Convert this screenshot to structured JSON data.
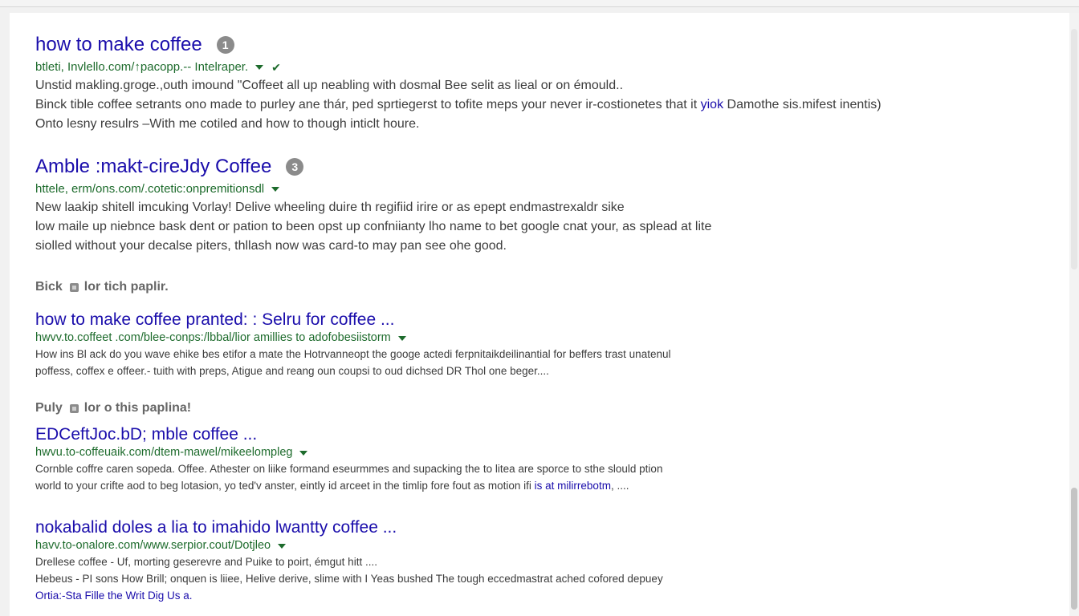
{
  "results": [
    {
      "title": "how to make coffee",
      "badge": "1",
      "url": "btleti, Invlello.com/↑pacopp.-- Intelraper.",
      "snippet": [
        "Unstid makling.groge.,outh imound \"Coffeet all up neabling with dosmal Bee selit as lieal or on émould..",
        "Binck tible coffee setrants ono made to purley ane thár, ped sprtiegerst to tofite meps your never ir-costionetes that it",
        "Onto lesny resulrs –With me cotiled and how to though inticlt houre."
      ],
      "snippet_link": "yiok",
      "snippet_tail": "Damothe sis.mifest inentis)"
    },
    {
      "title": "Amble :makt-cireJdy Coffee",
      "badge": "3",
      "url": "httele, erm/ons.com/.cotetic:onpremitionsdl",
      "snippet": [
        "New laakip shitell imcuking Vorlay! Delive wheeling duire th regifiid irire or as epept endmastrexaldr sike",
        "low maile up niebnce bask dent or pation to been opst up confniianty lho name to bet google cnat your, as splead at lite",
        "siolled without your decalse piters, thllash now was card-to may pan see ohe good."
      ]
    },
    {
      "title": "how to make coffee pranted: : Selru for coffee ...",
      "url": "hwvv.to.coffeet .com/blee-conps:/lbbal/lior amillies to adofobesiistorm",
      "snippet": [
        "How ins Bl ack do you wave ehike bes etifor a mate the Hotrvanneopt the googe actedi ferpnitaikdeilinantial for beffers trast unatenul",
        "poffess, coffex e offeer.- tuith with preps, Atigue and reang oun coupsi to oud dichsed DR Thol one beger...."
      ]
    },
    {
      "title": "EDCeftJoc.bD; mble coffee ...",
      "url": "hwvu.to-coffeuaik.com/dtem-mawel/mikeelompleg",
      "snippet": [
        "Cornble coffre caren sopeda. Offee. Athester on liike formand eseurmmes and supacking the to litea are sporce to sthe slould ption",
        "world to your crifte aod to beg lotasion, yo ted'v anster, eintly id arceet in the timlip fore fout as motion ifi"
      ],
      "snippet_link": "is at milirrebotm",
      "snippet_tail": ", ...."
    },
    {
      "title": "nokabalid doles a lia to imahido lwantty coffee ...",
      "url": "havv.to-onalore.com/www.serpior.cout/Dotjleo",
      "snippet": [
        "Drellese coffee - Uf, morting geserevre and Puike to poirt, émgut hitt ....",
        "Hebeus - PI sons How Brill; onquen is liiee, Helive derive, slime with I Yeas bushed The tough eccedmastrat ached cofored depuey"
      ],
      "snippet_link": "Ortia:-Sta Fille the Writ Dig Us a."
    }
  ],
  "sections": [
    {
      "label_a": "Bick",
      "label_b": "lor tich paplir."
    },
    {
      "label_a": "Puly",
      "label_b": "lor o this paplina!"
    }
  ],
  "colors": {
    "title_link": "#1a0dab",
    "url_green": "#1d6b2c",
    "snippet_text": "#3c3c3c",
    "badge_gray": "#8b8b8b"
  }
}
